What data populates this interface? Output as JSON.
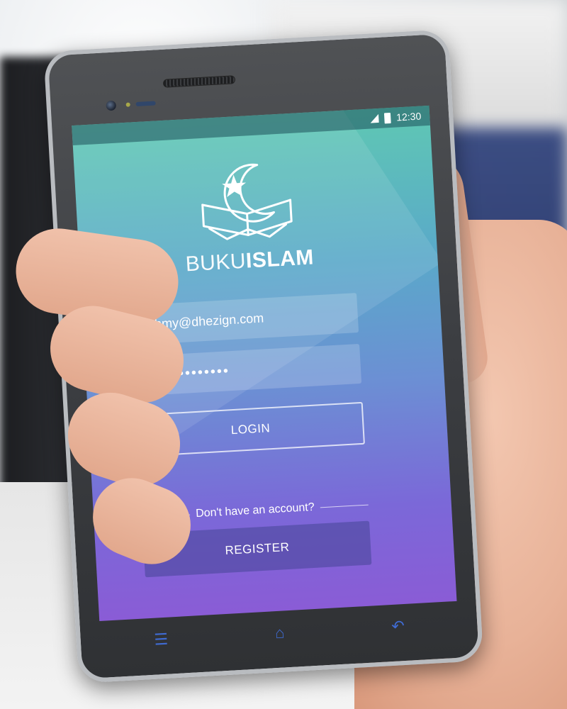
{
  "status_bar": {
    "time": "12:30"
  },
  "brand": {
    "light": "BUKU",
    "bold": "ISLAM"
  },
  "login_form": {
    "email_value": "fahmy@dhezign.com",
    "password_value": "•••••••••••••",
    "login_label": "LOGIN",
    "no_account_text": "Don't have an account?",
    "register_label": "REGISTER"
  },
  "nav_icons": [
    "menu-icon",
    "home-icon",
    "back-icon"
  ],
  "colors": {
    "gradient_top": "#5fc8b3",
    "gradient_bottom": "#8a5cd6",
    "nav_icon": "#3f6bd3"
  }
}
